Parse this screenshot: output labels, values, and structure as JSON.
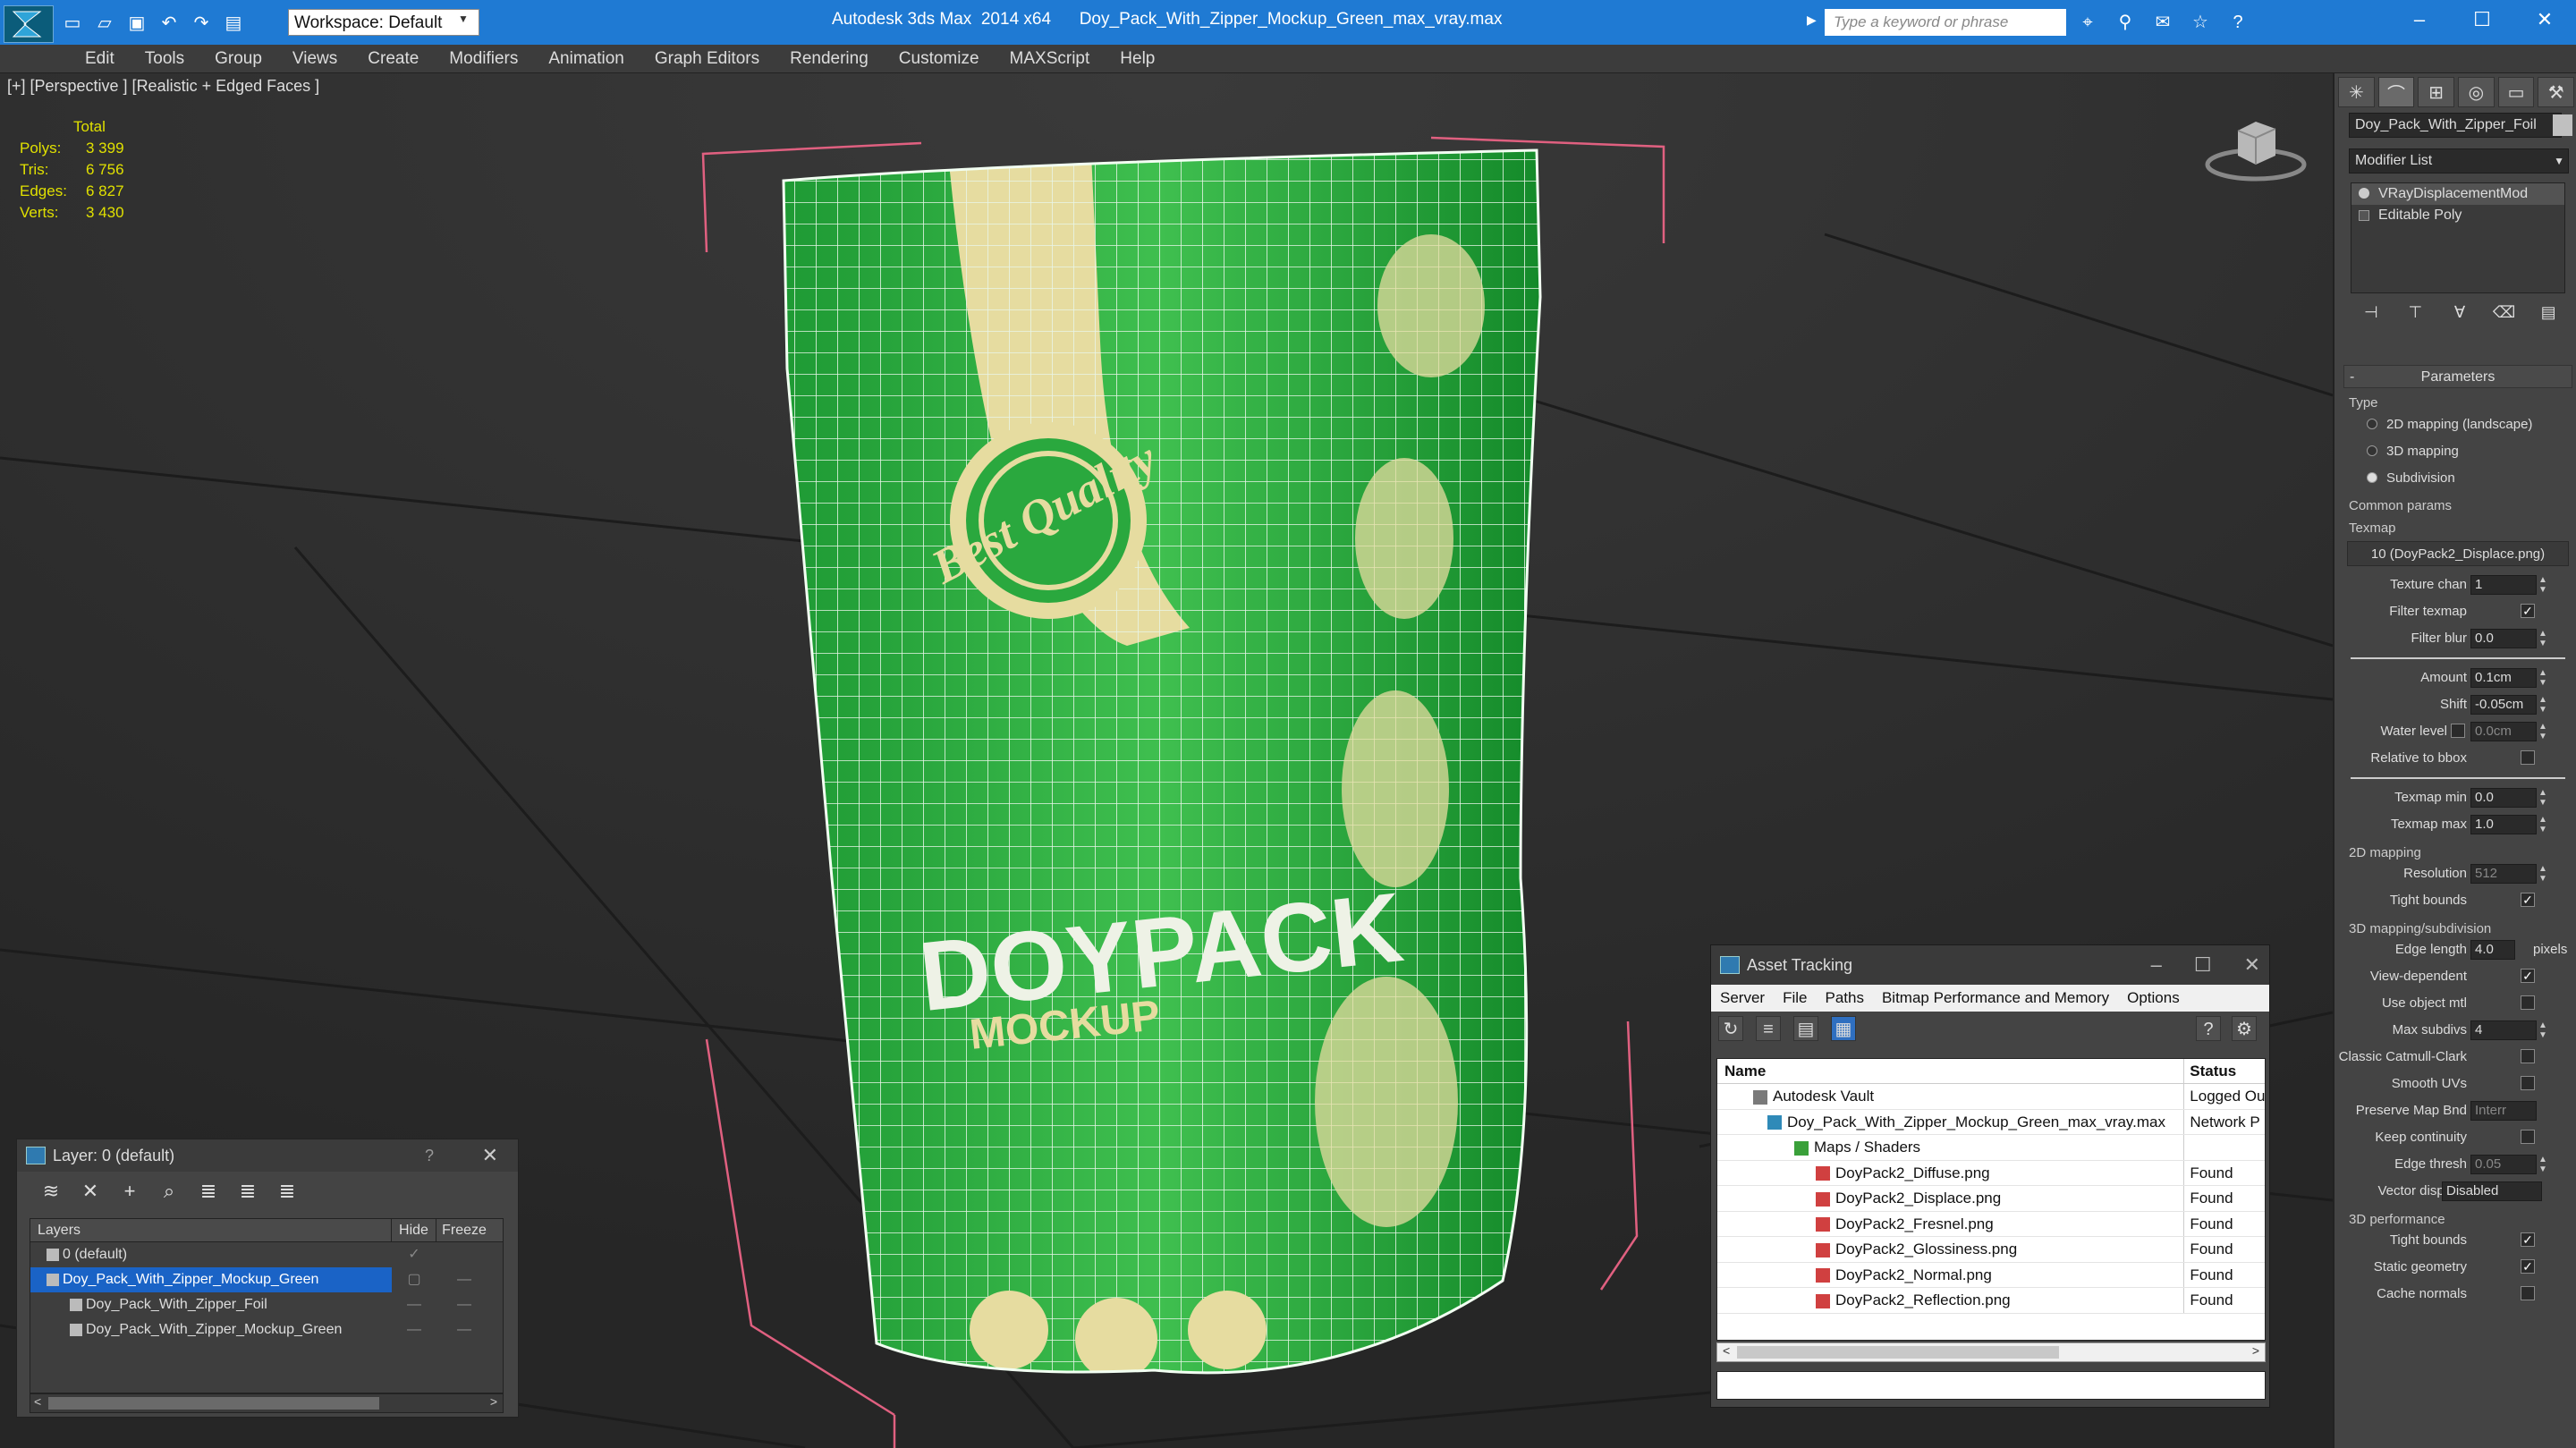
{
  "titlebar": {
    "workspace_label": "Workspace: Default",
    "app_title": "Autodesk 3ds Max  2014 x64      Doy_Pack_With_Zipper_Mockup_Green_max_vray.max",
    "search_placeholder": "Type a keyword or phrase",
    "accent_color": "#1f7ad3"
  },
  "menu": [
    "Edit",
    "Tools",
    "Group",
    "Views",
    "Create",
    "Modifiers",
    "Animation",
    "Graph Editors",
    "Rendering",
    "Customize",
    "MAXScript",
    "Help"
  ],
  "viewport": {
    "label": "[+] [Perspective ] [Realistic + Edged Faces ]",
    "stats": {
      "header": "Total",
      "rows": [
        {
          "k": "Polys:",
          "v": "3 399"
        },
        {
          "k": "Tris:",
          "v": "6 756"
        },
        {
          "k": "Edges:",
          "v": "6 827"
        },
        {
          "k": "Verts:",
          "v": "3 430"
        }
      ]
    },
    "package_text": {
      "title": "DOYPACK",
      "subtitle": "MOCKUP",
      "badge": "Best Quality"
    }
  },
  "command_panel": {
    "object_name": "Doy_Pack_With_Zipper_Foil",
    "modifier_list": "Modifier List",
    "stack": [
      "VRayDisplacementMod",
      "Editable Poly"
    ],
    "params_title": "Parameters",
    "type_label": "Type",
    "types": [
      {
        "label": "2D mapping (landscape)",
        "on": false
      },
      {
        "label": "3D mapping",
        "on": false
      },
      {
        "label": "Subdivision",
        "on": true
      }
    ],
    "common_label": "Common params",
    "texmap_label": "Texmap",
    "texmap_value": "10 (DoyPack2_Displace.png)",
    "texture_chan": {
      "label": "Texture chan",
      "value": "1"
    },
    "filter_texmap": {
      "label": "Filter texmap",
      "checked": "✓"
    },
    "filter_blur": {
      "label": "Filter blur",
      "value": "0.0"
    },
    "amount": {
      "label": "Amount",
      "value": "0.1cm"
    },
    "shift": {
      "label": "Shift",
      "value": "-0.05cm"
    },
    "water_level": {
      "label": "Water level",
      "value": "0.0cm"
    },
    "relative_bbox": {
      "label": "Relative to bbox",
      "checked": ""
    },
    "texmap_min": {
      "label": "Texmap min",
      "value": "0.0"
    },
    "texmap_max": {
      "label": "Texmap max",
      "value": "1.0"
    },
    "mapping2d_label": "2D mapping",
    "resolution": {
      "label": "Resolution",
      "value": "512"
    },
    "tight_bounds": {
      "label": "Tight bounds",
      "checked": "✓"
    },
    "mapping3d_label": "3D mapping/subdivision",
    "edge_length": {
      "label": "Edge length",
      "value": "4.0",
      "unit": "pixels"
    },
    "view_dependent": {
      "label": "View-dependent",
      "checked": "✓"
    },
    "use_object_mtl": {
      "label": "Use object mtl",
      "checked": ""
    },
    "max_subdivs": {
      "label": "Max subdivs",
      "value": "4"
    },
    "classic_catmull": {
      "label": "Classic Catmull-Clark",
      "checked": ""
    },
    "smooth_uvs": {
      "label": "Smooth UVs",
      "checked": ""
    },
    "preserve_map": {
      "label": "Preserve Map Bnd",
      "value": "Interr"
    },
    "keep_continuity": {
      "label": "Keep continuity",
      "checked": ""
    },
    "edge_thresh": {
      "label": "Edge thresh",
      "value": "0.05"
    },
    "vector_displ": {
      "label": "Vector displ",
      "value": "Disabled"
    },
    "perf_label": "3D performance",
    "perf_tight_bounds": {
      "label": "Tight bounds",
      "checked": "✓"
    },
    "static_geometry": {
      "label": "Static geometry",
      "checked": "✓"
    },
    "cache_normals": {
      "label": "Cache normals",
      "checked": ""
    }
  },
  "layer_panel": {
    "title": "Layer: 0 (default)",
    "help": "?",
    "columns": {
      "name": "Layers",
      "hide": "Hide",
      "freeze": "Freeze"
    },
    "rows": [
      {
        "name": "0 (default)",
        "hide": "✓",
        "freeze": "",
        "indent": "1",
        "sel": false
      },
      {
        "name": "Doy_Pack_With_Zipper_Mockup_Green",
        "hide": "▢",
        "freeze": "—",
        "indent": "1",
        "sel": true
      },
      {
        "name": "Doy_Pack_With_Zipper_Foil",
        "hide": "—",
        "freeze": "—",
        "indent": "2",
        "sel": false
      },
      {
        "name": "Doy_Pack_With_Zipper_Mockup_Green",
        "hide": "—",
        "freeze": "—",
        "indent": "2",
        "sel": false
      }
    ]
  },
  "asset_panel": {
    "title": "Asset Tracking",
    "menu": [
      "Server",
      "File",
      "Paths",
      "Bitmap Performance and Memory",
      "Options"
    ],
    "columns": {
      "name": "Name",
      "status": "Status"
    },
    "rows": [
      {
        "name": "Autodesk Vault",
        "status": "Logged Ou",
        "indent": "1"
      },
      {
        "name": "Doy_Pack_With_Zipper_Mockup_Green_max_vray.max",
        "status": "Network P",
        "indent": "2"
      },
      {
        "name": "Maps / Shaders",
        "status": "",
        "indent": "3"
      },
      {
        "name": "DoyPack2_Diffuse.png",
        "status": "Found",
        "indent": "4"
      },
      {
        "name": "DoyPack2_Displace.png",
        "status": "Found",
        "indent": "4"
      },
      {
        "name": "DoyPack2_Fresnel.png",
        "status": "Found",
        "indent": "4"
      },
      {
        "name": "DoyPack2_Glossiness.png",
        "status": "Found",
        "indent": "4"
      },
      {
        "name": "DoyPack2_Normal.png",
        "status": "Found",
        "indent": "4"
      },
      {
        "name": "DoyPack2_Reflection.png",
        "status": "Found",
        "indent": "4"
      }
    ]
  }
}
